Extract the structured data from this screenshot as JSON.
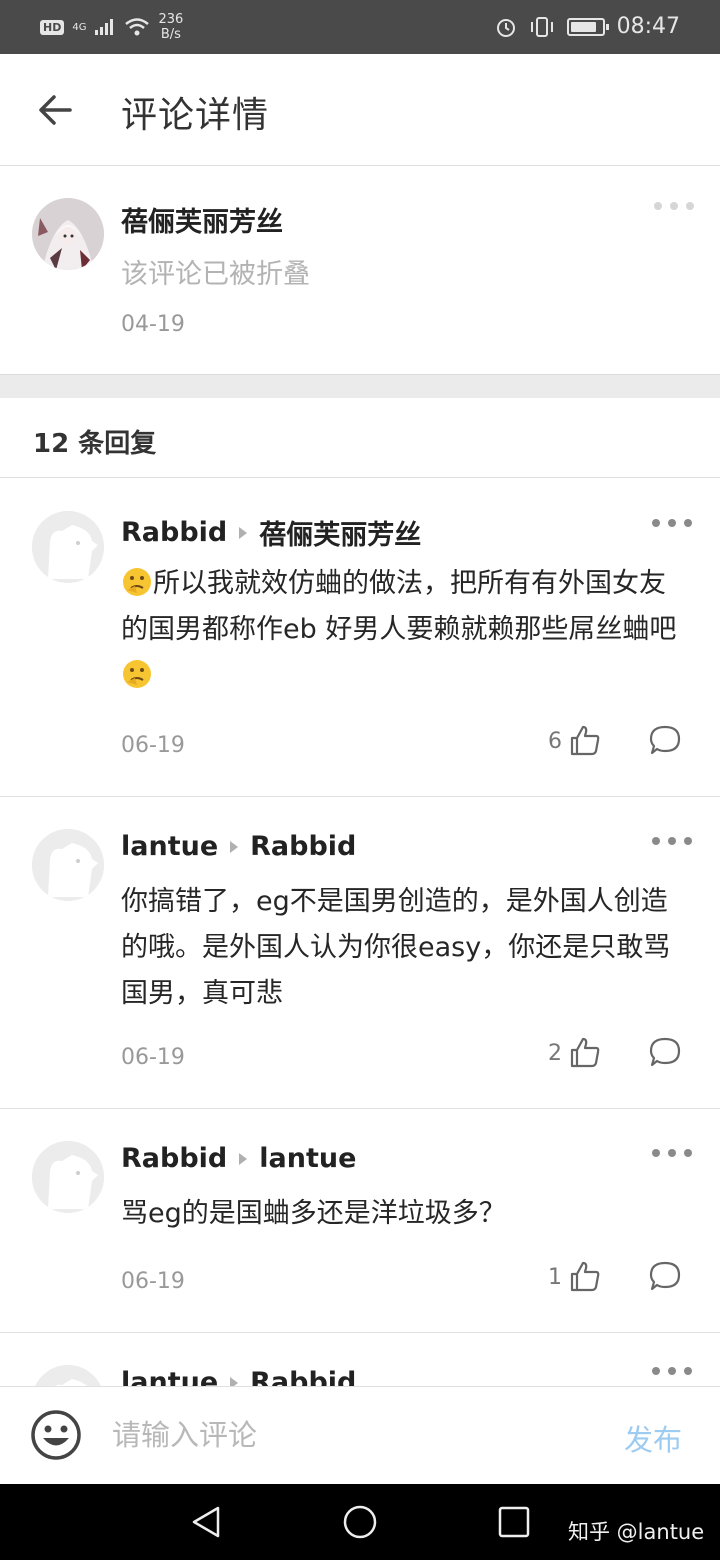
{
  "status_bar": {
    "net_speed_value": "236",
    "net_speed_unit": "B/s",
    "network": "4G",
    "time": "08:47",
    "battery_level": 0.85
  },
  "header": {
    "title": "评论详情"
  },
  "root_comment": {
    "author": "蓓俪芙丽芳丝",
    "content": "该评论已被折叠",
    "date": "04-19"
  },
  "reply_count_label": "12 条回复",
  "replies": [
    {
      "author": "Rabbid",
      "reply_to": "蓓俪芙丽芳丝",
      "text_parts": [
        "所以我就效仿蛐的做法，把所有有外国女友的国男都称作eb 好男人要赖就赖那些屌丝蛐吧"
      ],
      "date": "06-19",
      "likes": "6"
    },
    {
      "author": "lantue",
      "reply_to": "Rabbid",
      "text_parts": [
        "你搞错了，eg不是国男创造的，是外国人创造的哦。是外国人认为你很easy，你还是只敢骂国男，真可悲"
      ],
      "date": "06-19",
      "likes": "2"
    },
    {
      "author": "Rabbid",
      "reply_to": "lantue",
      "text_parts": [
        "骂eg的是国蛐多还是洋垃圾多？"
      ],
      "date": "06-19",
      "likes": "1"
    },
    {
      "author": "lantue",
      "reply_to": "Rabbid"
    }
  ],
  "input": {
    "placeholder": "请输入评论",
    "publish_label": "发布"
  },
  "watermark": "知乎 @lantue",
  "colors": {
    "status_bar_bg": "#4a4a4a",
    "publish_disabled": "#9ecbf0",
    "separator_band": "#ebebeb"
  }
}
